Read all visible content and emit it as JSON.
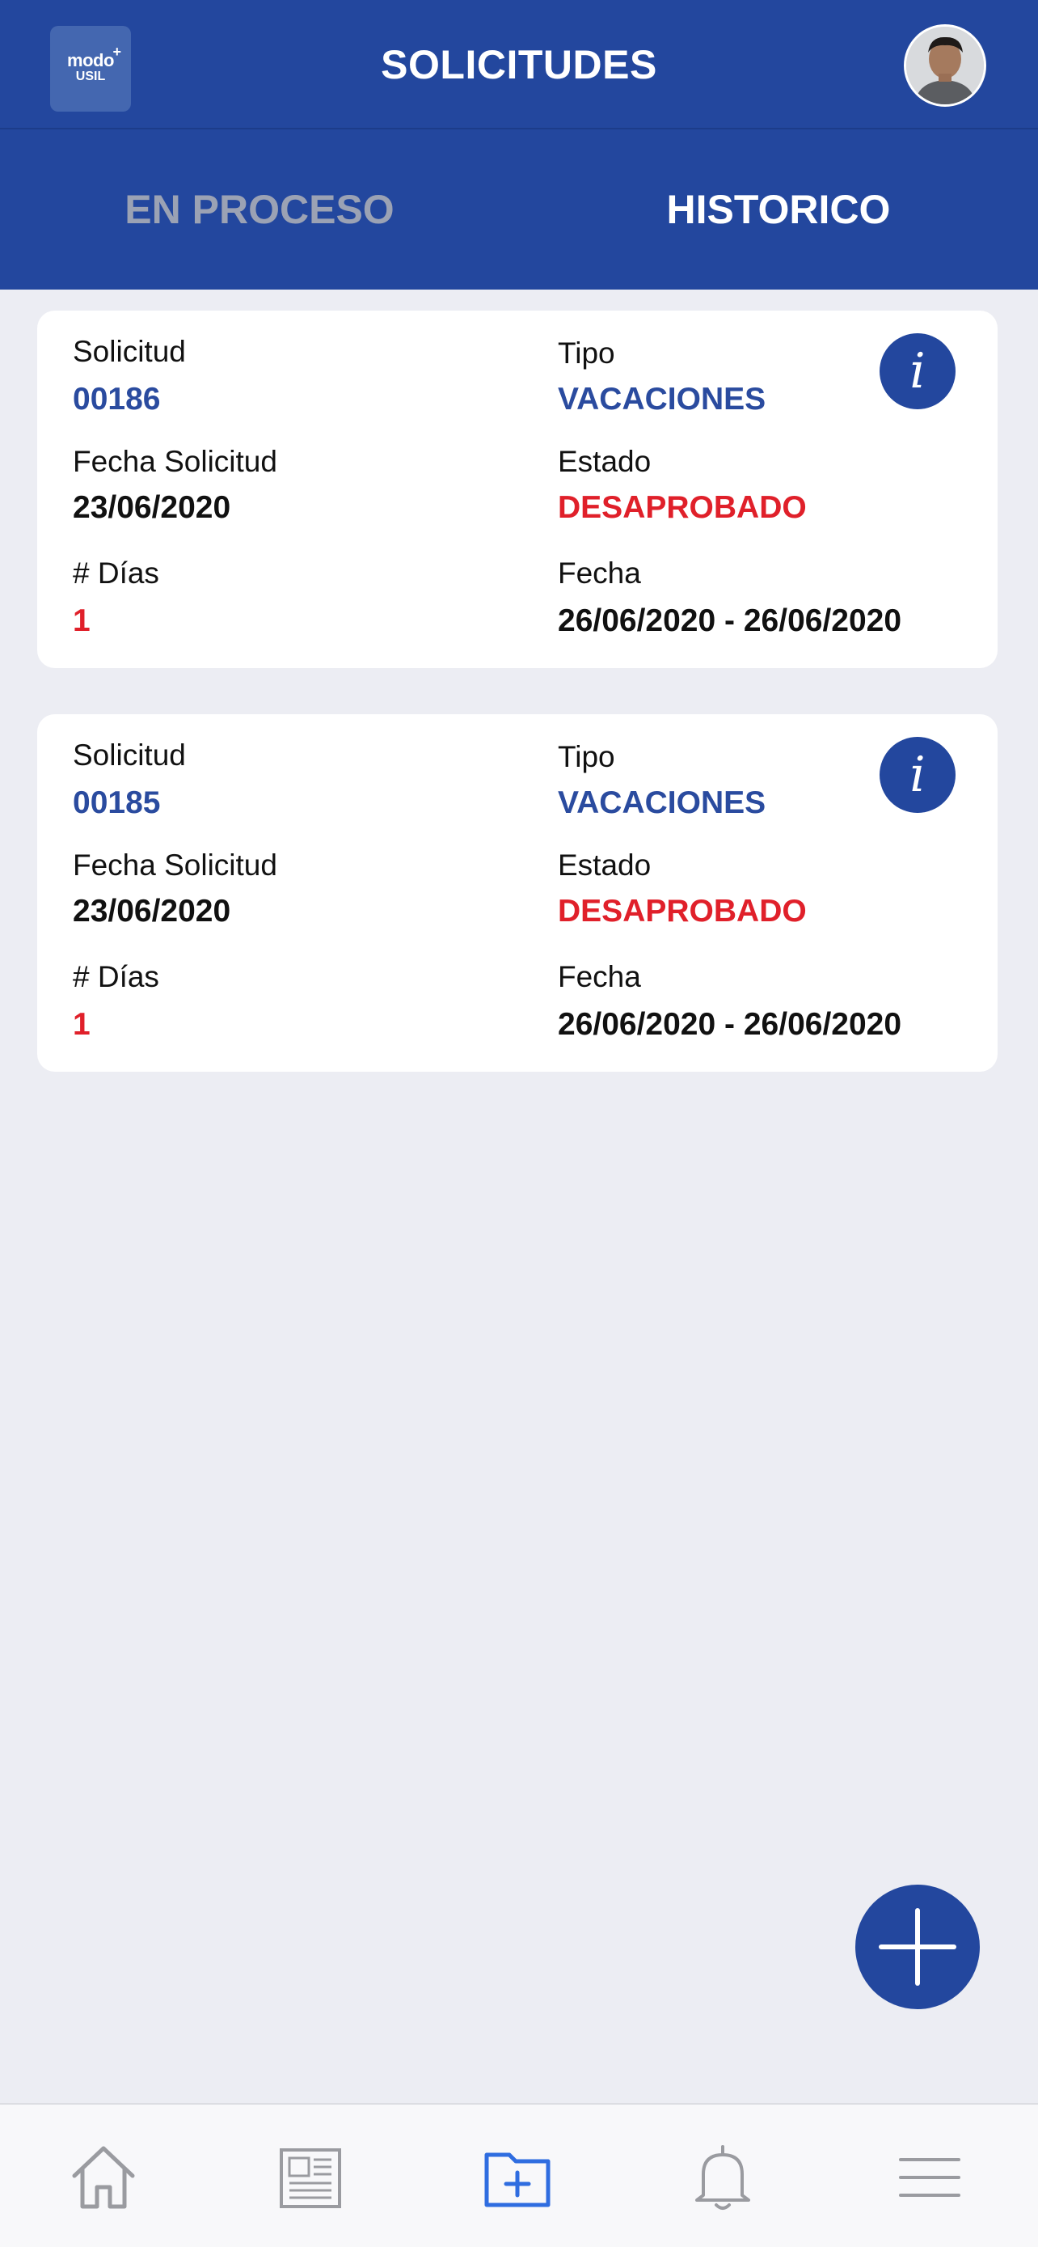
{
  "header": {
    "logo_line1": "modo",
    "logo_line2": "USIL",
    "logo_plus": "+",
    "title": "SOLICITUDES",
    "avatar_icon": "user-avatar"
  },
  "tabs": [
    {
      "label": "EN PROCESO",
      "active": false
    },
    {
      "label": "HISTORICO",
      "active": true
    }
  ],
  "colors": {
    "brand_blue": "#23479e",
    "status_red": "#e0202a",
    "inactive_tab": "#9ba2b4",
    "background": "#ecedf3"
  },
  "requests": [
    {
      "solicitud_label": "Solicitud",
      "solicitud": "00186",
      "tipo_label": "Tipo",
      "tipo": "VACACIONES",
      "fecha_solicitud_label": "Fecha Solicitud",
      "fecha_solicitud": "23/06/2020",
      "estado_label": "Estado",
      "estado": "DESAPROBADO",
      "dias_label": "# Días",
      "dias": "1",
      "fecha_label": "Fecha",
      "fecha": "26/06/2020 - 26/06/2020",
      "info_icon": "i"
    },
    {
      "solicitud_label": "Solicitud",
      "solicitud": "00185",
      "tipo_label": "Tipo",
      "tipo": "VACACIONES",
      "fecha_solicitud_label": "Fecha Solicitud",
      "fecha_solicitud": "23/06/2020",
      "estado_label": "Estado",
      "estado": "DESAPROBADO",
      "dias_label": "# Días",
      "dias": "1",
      "fecha_label": "Fecha",
      "fecha": "26/06/2020 - 26/06/2020",
      "info_icon": "i"
    }
  ],
  "fab": {
    "icon": "plus-icon"
  },
  "bottom_nav": [
    {
      "icon": "home-icon",
      "active": false
    },
    {
      "icon": "newspaper-icon",
      "active": false
    },
    {
      "icon": "folder-plus-icon",
      "active": true
    },
    {
      "icon": "bell-icon",
      "active": false
    },
    {
      "icon": "menu-icon",
      "active": false
    }
  ]
}
